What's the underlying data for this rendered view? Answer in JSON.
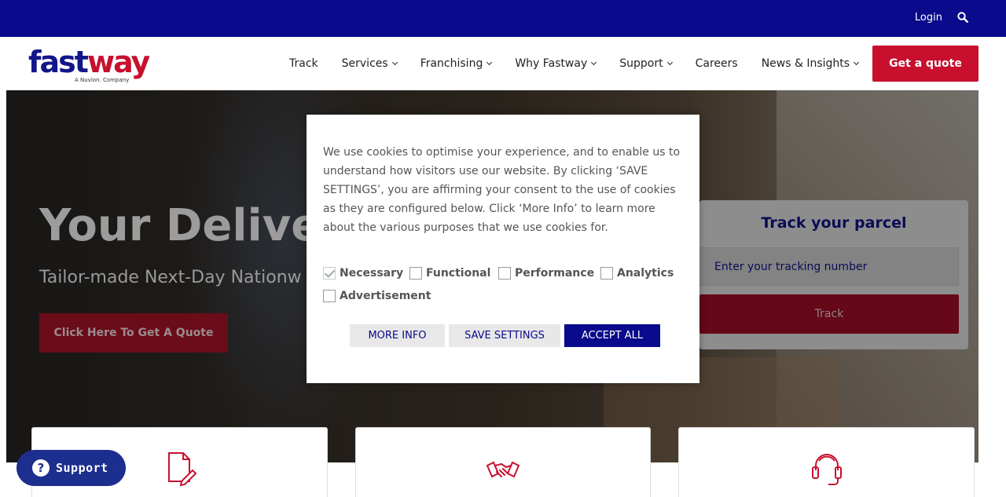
{
  "topbar": {
    "login_label": "Login",
    "search_icon": "search-icon"
  },
  "brand": {
    "logo_primary": "fast",
    "logo_accent": "way",
    "logo_sub": "A Nuvion. Company",
    "color_primary": "#12168a",
    "color_accent": "#c8102e"
  },
  "nav": {
    "items": [
      {
        "label": "Track",
        "has_dropdown": false
      },
      {
        "label": "Services",
        "has_dropdown": true
      },
      {
        "label": "Franchising",
        "has_dropdown": true
      },
      {
        "label": "Why Fastway",
        "has_dropdown": true
      },
      {
        "label": "Support",
        "has_dropdown": true
      },
      {
        "label": "Careers",
        "has_dropdown": false
      },
      {
        "label": "News & Insights",
        "has_dropdown": true
      }
    ],
    "cta_label": "Get a quote"
  },
  "hero": {
    "title": "Your Deliveri",
    "subtitle": "Tailor-made Next-Day Nationw",
    "cta_label": "Click Here To Get A Quote"
  },
  "track": {
    "title": "Track your parcel",
    "input_placeholder": "Enter your tracking number",
    "button_label": "Track"
  },
  "cookie_modal": {
    "text": "We use cookies to optimise your experience, and to enable us to understand how visitors use our website. By clicking ‘SAVE SETTINGS’, you are affirming your consent to the use of cookies as they are configured below. Click ‘More Info’ to learn more about the various purposes that we use cookies for.",
    "options": [
      {
        "label": "Necessary",
        "checked": true
      },
      {
        "label": "Functional",
        "checked": false
      },
      {
        "label": "Performance",
        "checked": false
      },
      {
        "label": "Analytics",
        "checked": false
      },
      {
        "label": "Advertisement",
        "checked": false
      }
    ],
    "more_info_label": "MORE INFO",
    "save_settings_label": "SAVE SETTINGS",
    "accept_all_label": "ACCEPT ALL"
  },
  "feature_cards": [
    {
      "icon": "document-pen-icon"
    },
    {
      "icon": "handshake-icon"
    },
    {
      "icon": "headset-icon"
    }
  ],
  "support_widget": {
    "label": "Support",
    "icon": "question-circle-icon"
  }
}
